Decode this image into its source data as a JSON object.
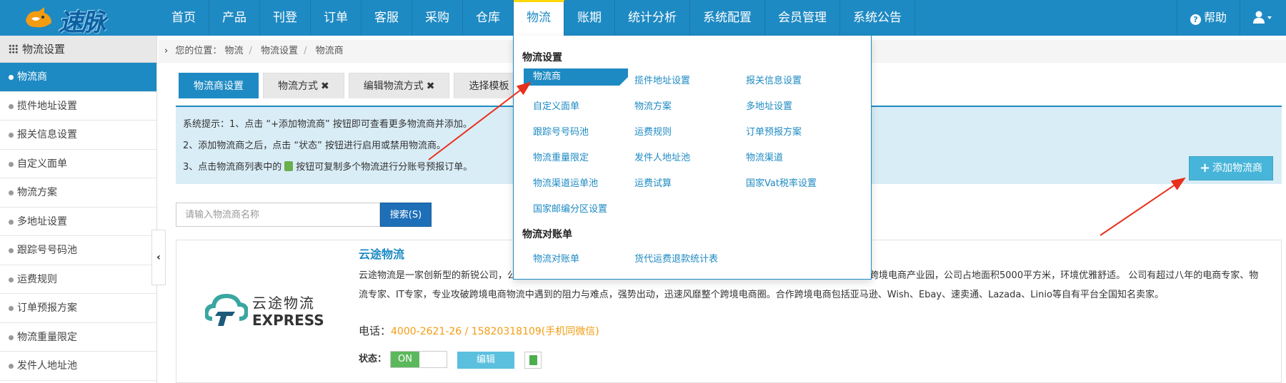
{
  "logo": {
    "brand_text": "速脉"
  },
  "nav": {
    "items": [
      "首页",
      "产品",
      "刊登",
      "订单",
      "客服",
      "采购",
      "仓库",
      "物流",
      "账期",
      "统计分析",
      "系统配置",
      "会员管理",
      "系统公告"
    ],
    "active": "物流",
    "help": "帮助",
    "user_icon": "user-icon"
  },
  "sidebar": {
    "title": "物流设置",
    "items": [
      "物流商",
      "揽件地址设置",
      "报关信息设置",
      "自定义面单",
      "物流方案",
      "多地址设置",
      "跟踪号号码池",
      "运费规则",
      "订单预报方案",
      "物流重量限定",
      "发件人地址池"
    ],
    "active": "物流商"
  },
  "breadcrumb": {
    "prefix": "您的位置：",
    "items": [
      "物流",
      "物流设置",
      "物流商"
    ]
  },
  "tabs": [
    {
      "label": "物流商设置",
      "closable": false,
      "active": true
    },
    {
      "label": "物流方式",
      "closable": true,
      "active": false
    },
    {
      "label": "编辑物流方式",
      "closable": true,
      "active": false
    },
    {
      "label": "选择模板",
      "closable": false,
      "active": false
    }
  ],
  "notice": {
    "line1": "系统提示：1、点击 “+添加物流商” 按钮即可查看更多物流商并添加。",
    "line2": "2、添加物流商之后，点击 “状态” 按钮进行启用或禁用物流商。",
    "line3_pre": "3、点击物流商列表中的",
    "line3_post": "按钮可复制多个物流进行分账号预报订单。",
    "add_button": "添加物流商"
  },
  "search": {
    "placeholder": "请输入物流商名称",
    "button": "搜索(S)"
  },
  "carrier": {
    "name": "云途物流",
    "logo_cn": "云途物流",
    "logo_en": "EXPRESS",
    "description": "云途物流是一家创新型的新锐公司，公司总部位于中国跨境电商之都深圳。目前总部已搬迁至位于深圳市龙岗区坂田街道赛盒跨境电商产业园，公司占地面积5000平方米，环境优雅舒适。 公司有超过八年的电商专家、物流专家、IT专家，专业攻破跨境电商物流中遇到的阻力与难点，强势出动，迅速风靡整个跨境电商圈。合作跨境电商包括亚马逊、Wish、Ebay、速卖通、Lazada、Linio等自有平台全国知名卖家。",
    "phone_label": "电话：",
    "phone": "4000-2621-26 / 15820318109(手机同微信)",
    "status_label": "状态：",
    "status_value": "ON",
    "edit_button": "编辑"
  },
  "dropdown": {
    "section1_title": "物流设置",
    "section1_links": [
      "物流商",
      "揽件地址设置",
      "报关信息设置",
      "自定义面单",
      "物流方案",
      "多地址设置",
      "跟踪号号码池",
      "运费规则",
      "订单预报方案",
      "物流重量限定",
      "发件人地址池",
      "物流渠道",
      "物流渠道运单池",
      "运费试算",
      "国家Vat税率设置",
      "国家邮编分区设置"
    ],
    "section2_title": "物流对账单",
    "section2_links": [
      "物流对账单",
      "货代运费退款统计表"
    ]
  },
  "colors": {
    "primary": "#1e8ac3",
    "accent_yellow": "#ffd800",
    "phone_orange": "#f39c12",
    "toggle_green": "#5cb85c",
    "edit_blue": "#5bc0de",
    "arrow_red": "#e8301c"
  }
}
